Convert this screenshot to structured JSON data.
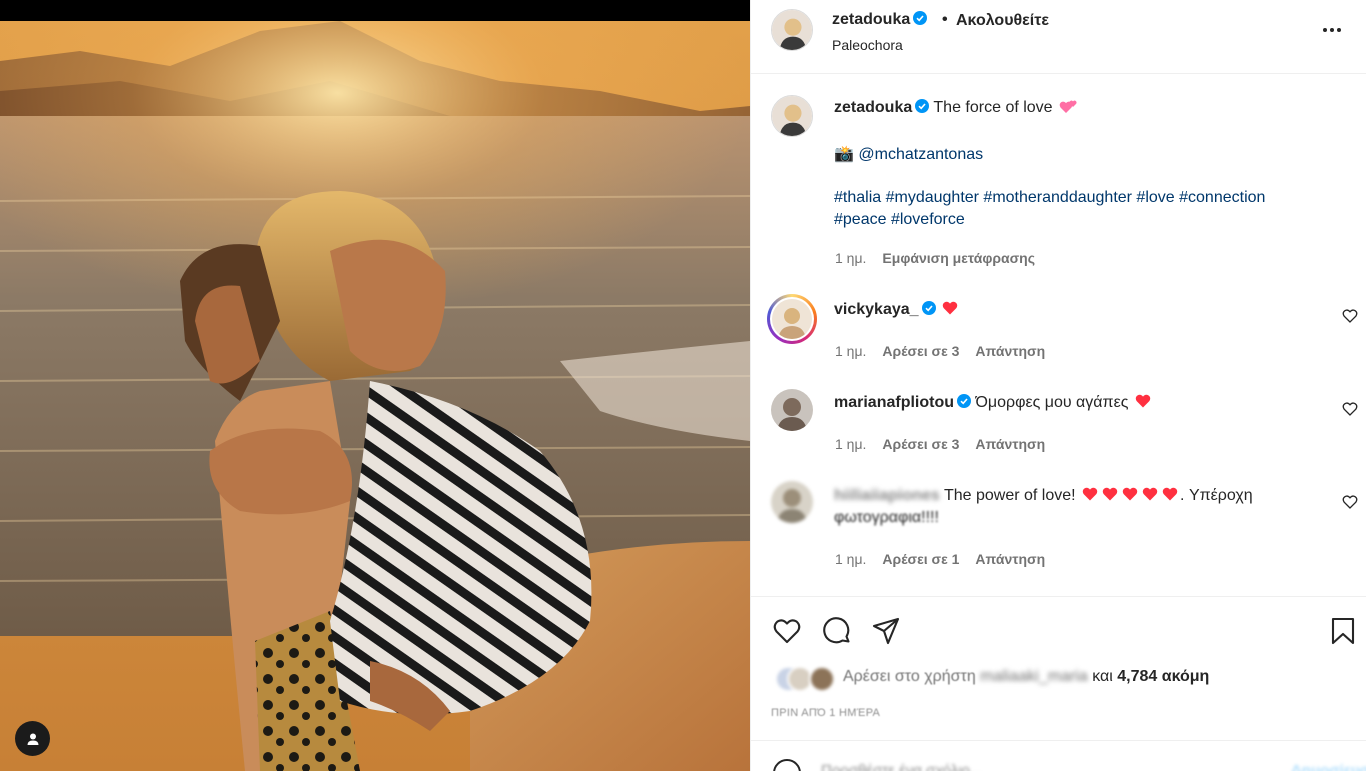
{
  "post": {
    "author": "zetadouka",
    "follow_status": "Ακολουθείτε",
    "dot": "•",
    "location": "Paleochora",
    "caption_text": "The force of love",
    "caption_camera": "📸",
    "caption_mention": "@mchatzantonas",
    "hashtags_line1": "#thalia #mydaughter #motheranddaughter #love #connection",
    "hashtags_line2": "#peace #loveforce",
    "time": "1 ημ.",
    "translation": "Εμφάνιση μετάφρασης"
  },
  "comments": [
    {
      "user": "vickykaya_",
      "text": "",
      "time": "1 ημ.",
      "likes": "Αρέσει σε 3",
      "reply": "Απάντηση"
    },
    {
      "user": "marianafpliotou",
      "text": "Όμορφες μου αγάπες",
      "time": "1 ημ.",
      "likes": "Αρέσει σε 3",
      "reply": "Απάντηση"
    },
    {
      "user": "hiiliaiiapiones",
      "text_part1": "The power of love!",
      "text_part2": ". Υπέροχη",
      "text_line2": "φωτογραφια!!!!",
      "time": "1 ημ.",
      "likes": "Αρέσει σε 1",
      "reply": "Απάντηση"
    }
  ],
  "likes": {
    "prefix": "Αρέσει στο χρήστη",
    "user": "maliaaki_maria",
    "connector": "και",
    "count": "4,784 ακόμη"
  },
  "date": "ΠΡΙΝ ΑΠΌ 1 ΗΜΈΡΑ",
  "add_comment": {
    "placeholder": "Προσθέστε ένα σχόλιο...",
    "post_label": "Δημοσίευση"
  },
  "colors": {
    "verified": "#0095f6",
    "heart": "#ff3040",
    "pink_hearts": "#ff6fa5",
    "link": "#00376b",
    "muted": "#737373"
  },
  "icons": [
    "user-tag-icon",
    "more-options-icon",
    "verified-badge-icon",
    "heart-icon",
    "comment-icon",
    "share-icon",
    "bookmark-icon",
    "emoji-icon",
    "camera-emoji",
    "red-heart-emoji",
    "two-hearts-emoji"
  ]
}
